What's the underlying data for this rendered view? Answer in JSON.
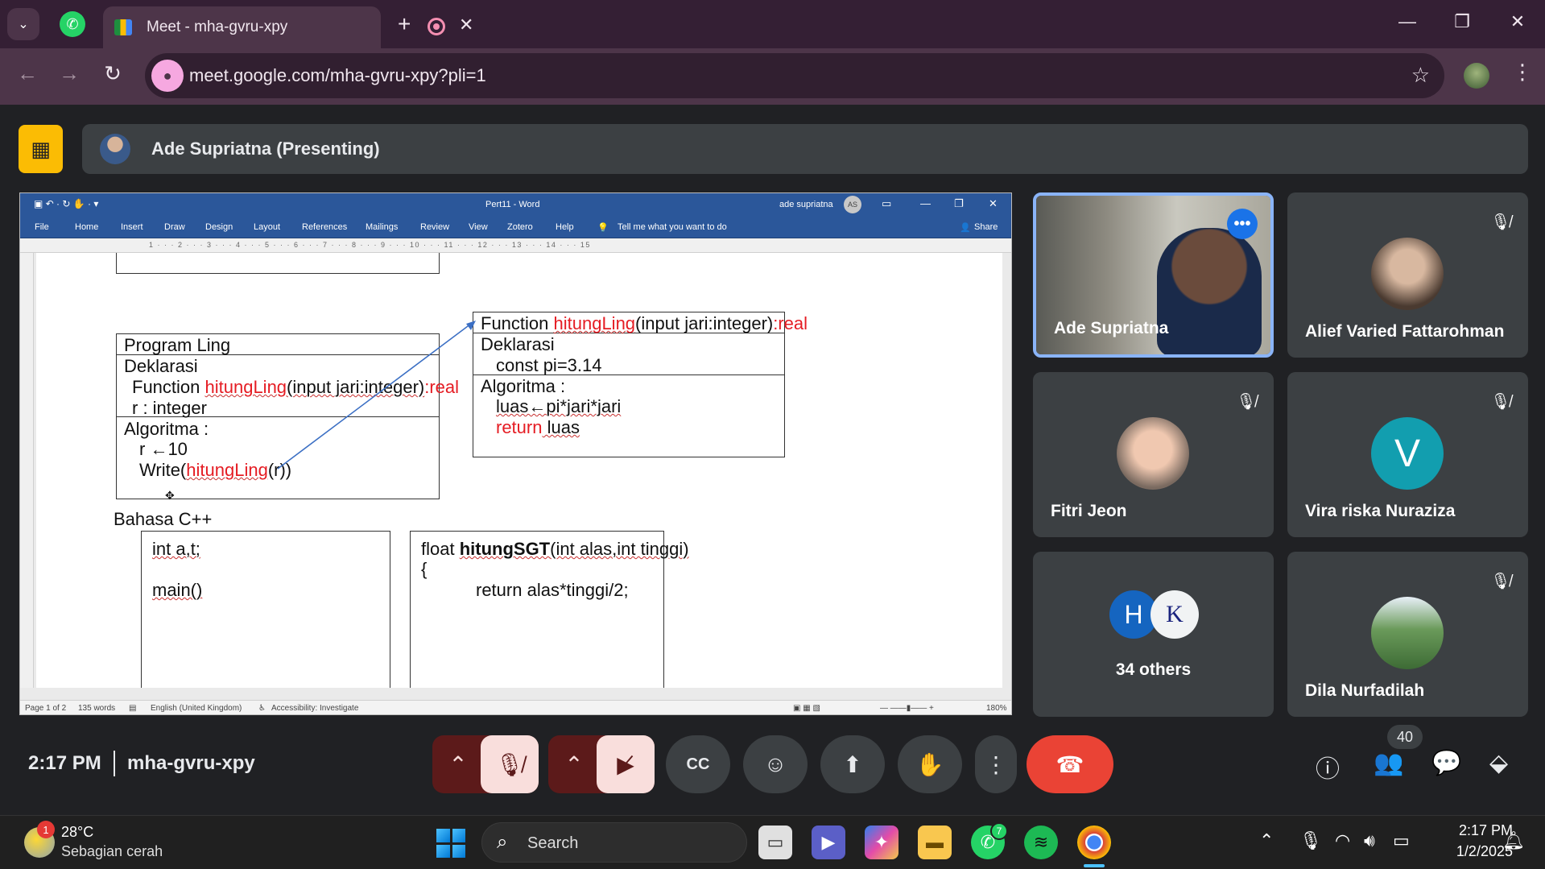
{
  "browser": {
    "tab_title": "Meet - mha-gvru-xpy",
    "url": "meet.google.com/mha-gvru-xpy?pli=1",
    "icons": [
      "chevron-down-icon",
      "whatsapp-icon",
      "record-icon",
      "close-icon",
      "plus-icon",
      "minimize-icon",
      "restore-icon",
      "close-window-icon",
      "back-icon",
      "forward-icon",
      "reload-icon",
      "mic-icon",
      "star-icon",
      "menu-icon"
    ]
  },
  "meet": {
    "presenter_label": "Ade Supriatna (Presenting)",
    "time": "2:17 PM",
    "meeting_code": "mha-gvru-xpy",
    "participant_count": "40",
    "accent_colors": {
      "end_call": "#ea4335",
      "presenting": "#fbbc04",
      "muted_controls": "#f9dedc"
    }
  },
  "word": {
    "title": "Pert11  -  Word",
    "user": "ade supriatna",
    "user_initials": "AS",
    "tabs": [
      "File",
      "Home",
      "Insert",
      "Draw",
      "Design",
      "Layout",
      "References",
      "Mailings",
      "Review",
      "View",
      "Zotero",
      "Help"
    ],
    "tell_me": "Tell me what you want to do",
    "share": "Share",
    "ruler": "1 · · · 2 · · · 3 · · · 4 · · · 5 · · · 6 · · · 7 · · · 8 · · · 9 · · · 10 · · · 11 · · · 12 · · · 13 · · · 14 · · · 15",
    "status": {
      "page": "Page 1 of 2",
      "words": "135 words",
      "language": "English (United Kingdom)",
      "accessibility": "Accessibility: Investigate",
      "zoom": "180%"
    },
    "doc": {
      "program_title": "Program Ling",
      "deklarasi": "Deklarasi",
      "fn_prefix": "Function  ",
      "fn_name": "hitungLing",
      "fn_params": "(input jari:integer)",
      "fn_return": ":real",
      "var_r": "r  : integer",
      "algoritma": "Algoritma :",
      "assign": "r ←10",
      "write_prefix": "Write(",
      "write_fn": "hitungLing",
      "write_suffix": "(r))",
      "fbox_fn_prefix": "Function  ",
      "fbox_fn_name": "hitungLing",
      "fbox_params": "(input jari:integer)",
      "fbox_return": ":real",
      "fbox_deklarasi": "Deklarasi",
      "fbox_const": "const pi=3.14",
      "fbox_algoritma": "Algoritma :",
      "fbox_luas": "luas←pi*jari*jari",
      "fbox_return_kw": "return",
      "fbox_return_val": " luas",
      "bahasa": "Bahasa C++",
      "cpp1_l1": "int a,t;",
      "cpp1_l2": "main()",
      "cpp2_l1_prefix": "float ",
      "cpp2_l1_fn": "hitungSGT",
      "cpp2_l1_suffix": "(int alas,int tinggi)",
      "cpp2_l2": "{",
      "cpp2_l3": "return alas*tinggi/2;"
    }
  },
  "participants": [
    {
      "name": "Ade Supriatna",
      "speaking": true
    },
    {
      "name": "Alief Varied Fattarohman",
      "muted": true
    },
    {
      "name": "Fitri Jeon",
      "muted": true
    },
    {
      "name": "Vira riska Nuraziza",
      "muted": true,
      "initial": "V",
      "color": "#129eaf"
    },
    {
      "name": "34 others",
      "initials": [
        "H",
        "K"
      ]
    },
    {
      "name": "Dila Nurfadilah",
      "muted": true
    }
  ],
  "taskbar": {
    "temperature": "28°C",
    "condition": "Sebagian cerah",
    "weather_badge": "1",
    "search": "Search",
    "whatsapp_badge": "7",
    "time": "2:17 PM",
    "date": "1/2/2025"
  }
}
